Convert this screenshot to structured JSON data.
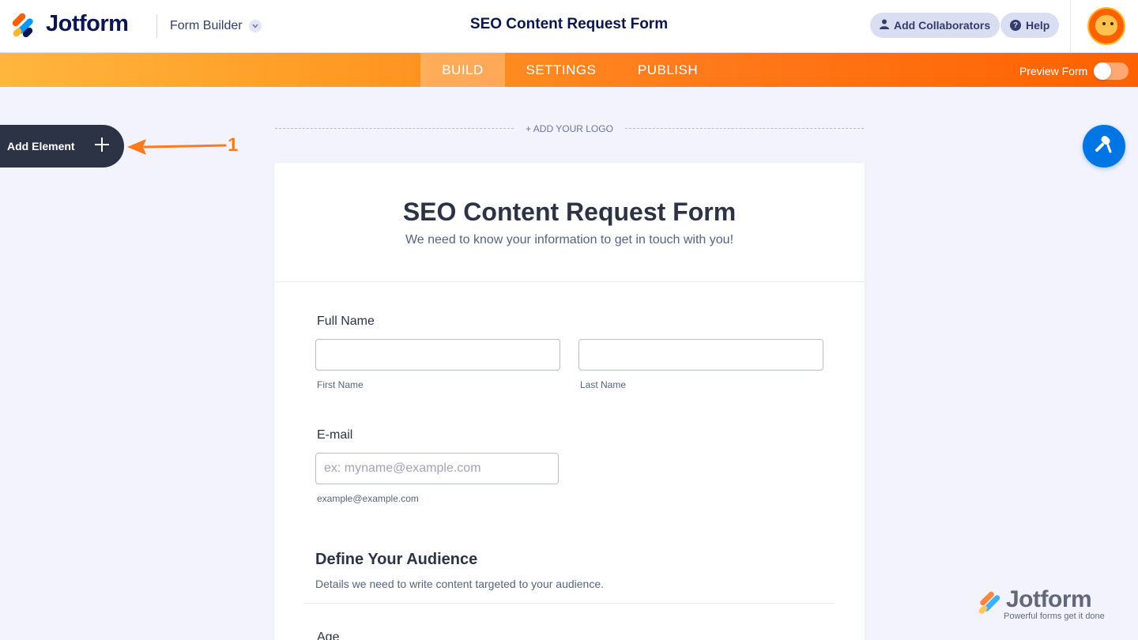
{
  "header": {
    "brand": "Jotform",
    "builder_dropdown": "Form Builder",
    "form_title": "SEO Content Request Form",
    "collaborators_label": "Add Collaborators",
    "help_label": "Help"
  },
  "nav": {
    "tabs": [
      {
        "label": "BUILD",
        "active": true
      },
      {
        "label": "SETTINGS",
        "active": false
      },
      {
        "label": "PUBLISH",
        "active": false
      }
    ],
    "preview_label": "Preview Form",
    "preview_on": false
  },
  "sidebar": {
    "add_element_label": "Add Element",
    "annotation_number": "1"
  },
  "canvas": {
    "add_logo_label": "+ ADD YOUR LOGO"
  },
  "form": {
    "title": "SEO Content Request Form",
    "subtitle": "We need to know your information to get in touch with you!",
    "full_name": {
      "label": "Full Name",
      "first_sublabel": "First Name",
      "last_sublabel": "Last Name",
      "first_value": "",
      "last_value": ""
    },
    "email": {
      "label": "E-mail",
      "placeholder": "ex: myname@example.com",
      "sublabel": "example@example.com"
    },
    "section": {
      "title": "Define Your Audience",
      "description": "Details we need to write content targeted to your audience."
    },
    "next_label": "Age"
  },
  "watermark": {
    "brand": "Jotform",
    "tagline": "Powerful forms get it done"
  },
  "colors": {
    "brand_navy": "#0a1551",
    "nav_orange": "#ff6100",
    "nav_yellow": "#ffb63e",
    "designer_blue": "#0075e3",
    "add_element_bg": "#2c3345"
  },
  "icons": {
    "collaborators": "user-icon",
    "help": "question-icon",
    "designer": "paint-roller-icon",
    "add": "plus-icon"
  }
}
